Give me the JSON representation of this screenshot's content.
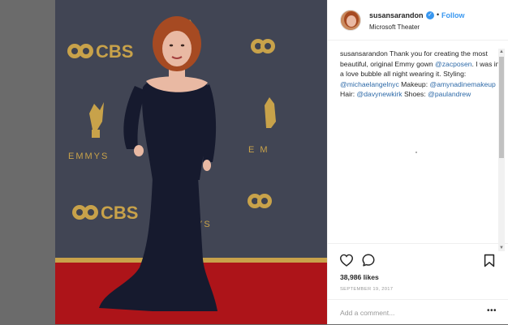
{
  "post": {
    "username": "susansarandon",
    "follow_label": "Follow",
    "separator": "•",
    "location": "Microsoft Theater",
    "caption": {
      "username": "susansarandon",
      "text_1": " Thank you for creating the most beautiful, original Emmy gown ",
      "mention_1": "@zacposen",
      "text_2": ". I was in a love bubble all night wearing it. Styling: ",
      "mention_2": "@michaelangelnyc",
      "text_3": " Makeup: ",
      "mention_3": "@amynadinemakeup",
      "text_4": " Hair: ",
      "mention_4": "@davynewkirk",
      "text_5": " Shoes: ",
      "mention_5": "@paulandrew"
    },
    "likes": "38,986 likes",
    "date": "SEPTEMBER 19, 2017",
    "comment_placeholder": "Add a comment...",
    "more_label": "•••"
  },
  "photo": {
    "backdrop_text_1": "CBS",
    "backdrop_text_2": "EMMYS",
    "backdrop_text_3": "YS",
    "colors": {
      "backdrop": "#3e4250",
      "carpet": "#b8161b",
      "gown": "#161a2e",
      "hair": "#a64a22",
      "skin": "#e9b9a3",
      "gold": "#c8a24a"
    }
  },
  "icons": {
    "heart": "heart-icon",
    "comment": "comment-icon",
    "bookmark": "bookmark-icon",
    "verified": "verified-badge-icon",
    "verified_glyph": "✓"
  },
  "colors": {
    "link": "#3897f0",
    "mention": "#2e6aa8",
    "text": "#262626",
    "muted": "#999999"
  }
}
